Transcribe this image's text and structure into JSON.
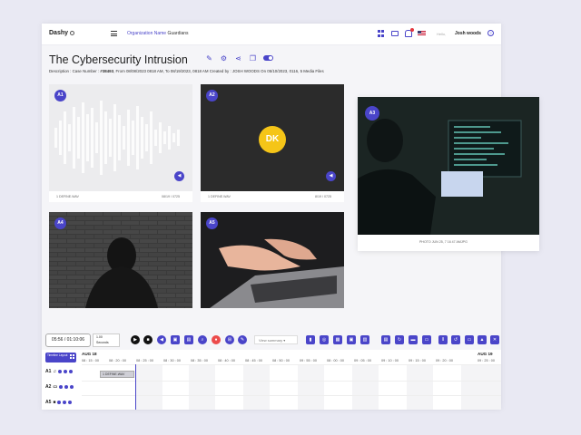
{
  "header": {
    "logo": "Dashy",
    "org_label": "Organization Name",
    "org_value": "Guardians",
    "hello": "Hello,",
    "user": "Josh woods"
  },
  "title": "The Cybersecurity Intrusion",
  "description": {
    "prefix": "Description : Case Number :",
    "case": "#38493",
    "from_label": "From",
    "from": "08/08/2023 0818 AM",
    "to_label": "To",
    "to": "08/19/2023, 0818 AM",
    "created_label": "Created by :",
    "created": "JOSH WOODS",
    "on_label": "On",
    "on": "05/10/2023, 0116,",
    "files": "5 Media Files"
  },
  "cards": [
    {
      "badge": "A1",
      "file": "1 DEFINE.WAV",
      "time": "08/19 / 0725"
    },
    {
      "badge": "A2",
      "file": "1 DEFINE.WAV",
      "time": "8/19 / 0725",
      "avatar": "DK"
    },
    {
      "badge": "A3",
      "caption": "PHOTO JUN 25, 7 16 47 AMJPG"
    },
    {
      "badge": "A4"
    },
    {
      "badge": "A5"
    }
  ],
  "controls": {
    "timecode": "05:56 / 01:10:06",
    "seconds_value": "1.00",
    "seconds_label": "Seconds",
    "view_select": "View summary"
  },
  "timeline": {
    "layout_label": "Timeline Layout",
    "month_left": "AUG 18",
    "month_right": "AUG 19",
    "ticks": [
      "08 : 15 : 00",
      "08 : 20 : 00",
      "08 : 25 : 00",
      "08 : 30 : 00",
      "08 : 35 : 00",
      "08 : 40 : 00",
      "08 : 45 : 00",
      "08 : 50 : 00",
      "09 : 55 : 00",
      "08 : 00 : 00",
      "09 : 05 : 00",
      "09 : 10 : 00",
      "09 : 15 : 00",
      "09 : 20 : 00",
      "09 : 25 : 00"
    ],
    "rows": [
      {
        "label": "A1",
        "icon": "music-note-icon"
      },
      {
        "label": "A2",
        "icon": "image-icon"
      },
      {
        "label": "A5",
        "icon": "video-icon"
      }
    ],
    "clip_label": "1 DEFINE.WAV"
  },
  "colors": {
    "accent": "#4a45c9",
    "avatar": "#f5c518"
  }
}
